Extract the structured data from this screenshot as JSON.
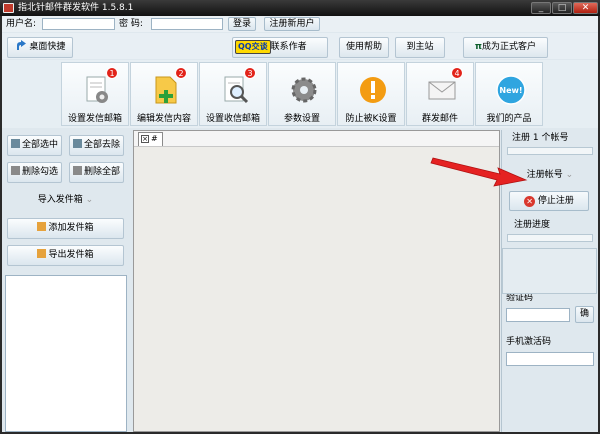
{
  "window": {
    "title": "指北针邮件群发软件 1.5.8.1",
    "minimize": "_",
    "maximize": "□",
    "close": "✕"
  },
  "login": {
    "user_label": "用户名:",
    "user_value": "",
    "pwd_label": "密 码:",
    "pwd_value": "",
    "login_button": "登录",
    "register_button": "注册新用户"
  },
  "toolbar": {
    "desktop_shortcut": "桌面快捷",
    "qq_badge": "QQ交谈",
    "contact_author": "联系作者",
    "help": "使用帮助",
    "homepage": "到主站",
    "become_customer": "成为正式客户"
  },
  "tools": [
    {
      "label": "设置发信邮箱",
      "badge": "1"
    },
    {
      "label": "编辑发信内容",
      "badge": "2"
    },
    {
      "label": "设置收信邮箱",
      "badge": "3"
    },
    {
      "label": "参数设置",
      "badge": ""
    },
    {
      "label": "防止被K设置",
      "badge": ""
    },
    {
      "label": "群发邮件",
      "badge": "4"
    },
    {
      "label": "我们的产品",
      "badge": "",
      "icon_text": "New!"
    }
  ],
  "left": {
    "select_all": "全部选中",
    "remove_all": "全部去除",
    "delete_checked": "删除勾选",
    "delete_all": "删除全部",
    "import": "导入发件箱",
    "add": "添加发件箱",
    "export": "导出发件箱"
  },
  "tab": {
    "label": "#"
  },
  "right": {
    "register_count": "注册 1 个帐号",
    "register_account": "注册帐号",
    "stop_register": "停止注册",
    "progress_label": "注册进度",
    "captcha_label": "验证码",
    "captcha_confirm": "确",
    "sms_label": "手机激活码"
  },
  "colors": {
    "accent_red": "#e2231a",
    "title_bar": "#1c1c1c",
    "panel_bg": "#dfe8ee"
  }
}
